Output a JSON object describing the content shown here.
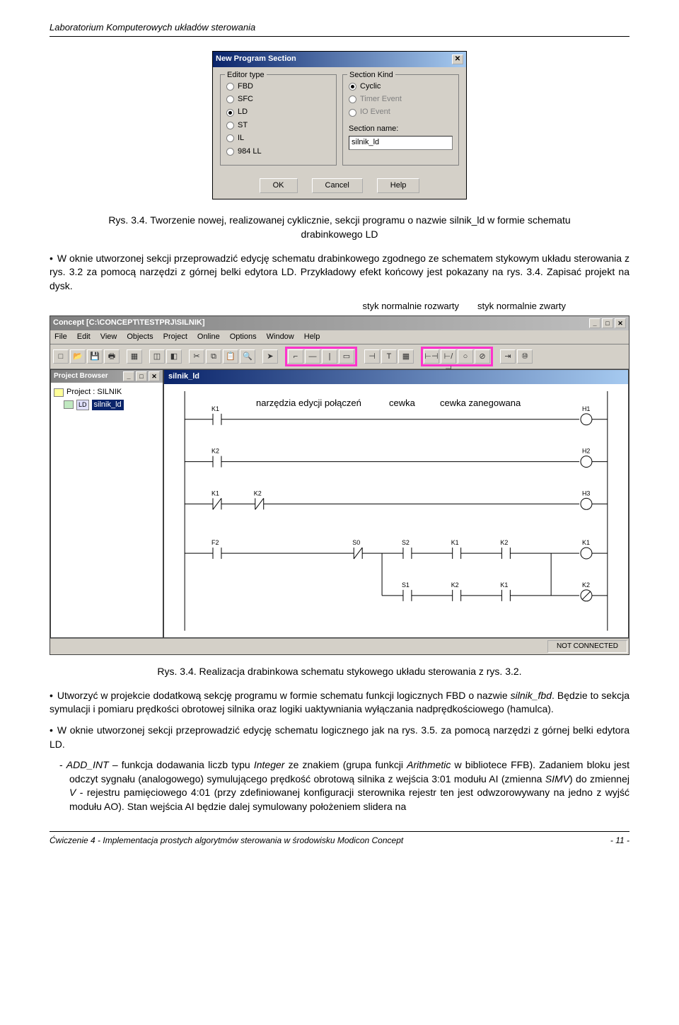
{
  "header": {
    "lab_title": "Laboratorium Komputerowych układów sterowania"
  },
  "dialog": {
    "title": "New Program Section",
    "editor_legend": "Editor type",
    "editor_options": [
      "FBD",
      "SFC",
      "LD",
      "ST",
      "IL",
      "984 LL"
    ],
    "editor_selected": "LD",
    "kind_legend": "Section Kind",
    "kind_options": [
      {
        "label": "Cyclic",
        "enabled": true
      },
      {
        "label": "Timer Event",
        "enabled": false
      },
      {
        "label": "IO Event",
        "enabled": false
      }
    ],
    "kind_selected": "Cyclic",
    "section_name_label": "Section name:",
    "section_name_value": "silnik_ld",
    "buttons": {
      "ok": "OK",
      "cancel": "Cancel",
      "help": "Help"
    }
  },
  "fig34_caption": "Rys. 3.4. Tworzenie nowej, realizowanej cyklicznie, sekcji programu o nazwie silnik_ld w formie schematu drabinkowego LD",
  "para1": "W oknie utworzonej sekcji przeprowadzić edycję schematu drabinkowego zgodnego ze schematem stykowym układu sterowania z rys. 3.2 za pomocą narzędzi z górnej belki edytora LD. Przykładowy efekt końcowy jest pokazany na rys. 3.4. Zapisać projekt na dysk.",
  "top_annot": {
    "left": "styk normalnie rozwarty",
    "right": "styk normalnie zwarty"
  },
  "appwin": {
    "title": "Concept [C:\\CONCEPT\\TESTPRJ\\SILNIK]",
    "menus": [
      "File",
      "Edit",
      "View",
      "Objects",
      "Project",
      "Online",
      "Options",
      "Window",
      "Help"
    ],
    "project_browser_title": "Project Browser",
    "project_name": "Project : SILNIK",
    "section_tree_ld": "LD",
    "section_tree_item": "silnik_ld",
    "ld_window_title": "silnik_ld",
    "status": "NOT CONNECTED",
    "mid_annot": {
      "l1": "narzędzia edycji połączeń",
      "l2": "cewka",
      "l3": "cewka zanegowana"
    },
    "ladder_labels": {
      "K1": "K1",
      "K2": "K2",
      "H1": "H1",
      "H2": "H2",
      "H3": "H3",
      "F2": "F2",
      "S0": "S0",
      "S1": "S1",
      "S2": "S2"
    }
  },
  "fig34b_caption": "Rys. 3.4. Realizacja drabinkowa schematu stykowego układu sterowania z rys. 3.2.",
  "para2_pre": "Utworzyć w projekcie dodatkową sekcję programu w formie schematu funkcji logicznych FBD o nazwie ",
  "para2_it": "silnik_fbd",
  "para2_post": ". Będzie to sekcja symulacji i pomiaru prędkości obrotowej silnika oraz logiki uaktywniania wyłączania nadprędkościowego (hamulca).",
  "para3": "W oknie utworzonej sekcji przeprowadzić edycję schematu logicznego jak na rys. 3.5. za pomocą narzędzi z górnej belki edytora LD.",
  "para4_pre": "- ",
  "para4_it1": "ADD_INT",
  "para4_mid1": " – funkcja dodawania liczb typu ",
  "para4_it2": "Integer",
  "para4_mid2": " ze znakiem (grupa funkcji ",
  "para4_it3": "Arithmetic",
  "para4_mid3": " w bibliotece FFB). Zadaniem bloku jest odczyt sygnału (analogowego) symulującego prędkość obrotową silnika z wejścia 3:01 modułu AI (zmienna ",
  "para4_it4": "SIMV",
  "para4_mid4": ") do zmiennej ",
  "para4_it5": "V",
  "para4_post": " - rejestru pamięciowego 4:01 (przy zdefiniowanej konfiguracji sterownika rejestr ten jest odwzorowywany na jedno z wyjść modułu AO). Stan wejścia AI będzie dalej symulowany położeniem slidera na",
  "footer": {
    "left": "Ćwiczenie 4 - Implementacja prostych algorytmów sterowania w środowisku Modicon Concept",
    "right": "- 11 -"
  }
}
